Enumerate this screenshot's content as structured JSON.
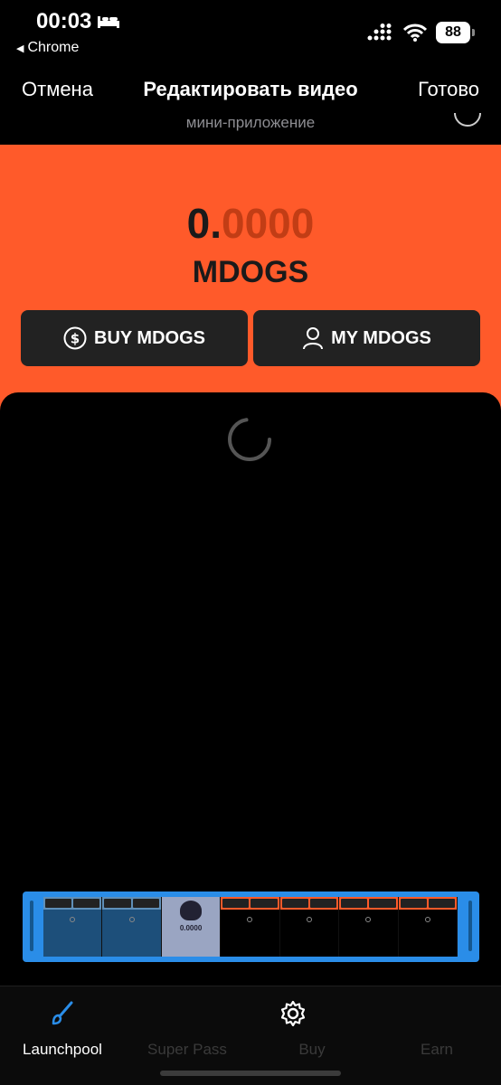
{
  "status_bar": {
    "time": "00:03",
    "back_app": "Chrome",
    "battery": "88"
  },
  "edit_header": {
    "cancel_label": "Отмена",
    "title": "Редактировать видео",
    "done_label": "Готово",
    "subtitle": "мини-приложение"
  },
  "wallet": {
    "balance_int": "0.",
    "balance_dec": "0000",
    "ticker": "MDOGS"
  },
  "actions": {
    "buy_label": "BUY MDOGS",
    "my_label": "MY MDOGS"
  },
  "timeline": {
    "mid_frame_text": "0.0000"
  },
  "tabs": [
    {
      "label": "Launchpool",
      "icon": "brush-icon",
      "active": true
    },
    {
      "label": "Super Pass",
      "icon": "pass-icon",
      "active": false
    },
    {
      "label": "Buy",
      "icon": "gear-icon",
      "active": false
    },
    {
      "label": "Earn",
      "icon": "earn-icon",
      "active": false
    }
  ],
  "colors": {
    "accent_orange": "#FF5A2A",
    "timeline_blue": "#2A8DE8",
    "active_tab_icon": "#2A8DE8"
  }
}
